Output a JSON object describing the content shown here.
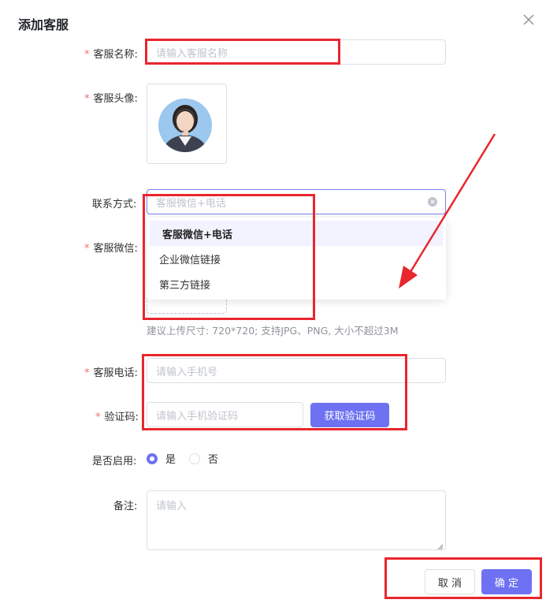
{
  "dialog": {
    "title": "添加客服",
    "close_icon": "close-icon"
  },
  "form": {
    "name": {
      "label": "客服名称:",
      "placeholder": "请输入客服名称",
      "required": true
    },
    "avatar": {
      "label": "客服头像:",
      "required": true
    },
    "contact": {
      "label": "联系方式:",
      "value": "客服微信+电话",
      "clear_icon": "clear-circle-icon",
      "options": [
        "客服微信+电话",
        "企业微信链接",
        "第三方链接"
      ],
      "selected_index": 0
    },
    "wechat": {
      "label": "客服微信:",
      "required": true,
      "hint": "建议上传尺寸: 720*720; 支持JPG、PNG, 大小不超过3M"
    },
    "phone": {
      "label": "客服电话:",
      "placeholder": "请输入手机号",
      "required": true
    },
    "code": {
      "label": "验证码:",
      "placeholder": "请输入手机验证码",
      "required": true,
      "button_label": "获取验证码"
    },
    "enabled": {
      "label": "是否启用:",
      "yes_label": "是",
      "no_label": "否",
      "value": "是"
    },
    "remark": {
      "label": "备注:",
      "placeholder": "请输入"
    }
  },
  "footer": {
    "cancel_label": "取 消",
    "confirm_label": "确 定"
  },
  "colors": {
    "primary": "#6d71f2",
    "required": "#f56c6c",
    "annotation": "#e8262e"
  }
}
